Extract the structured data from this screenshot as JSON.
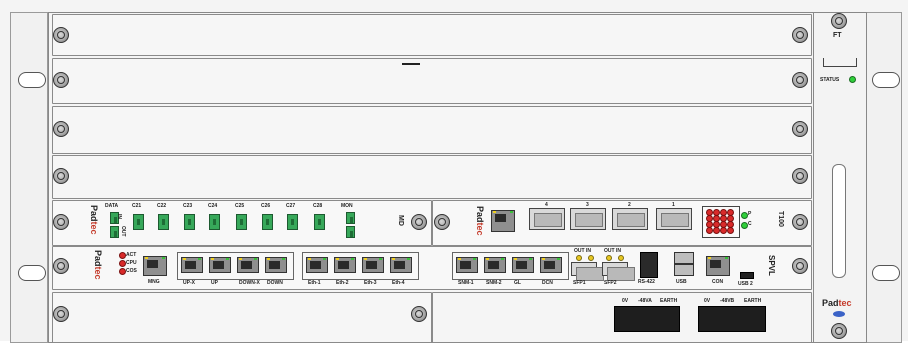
{
  "colors": {
    "led_green": "#2fcf3a",
    "led_red": "#d92a2a",
    "led_yellow": "#e7c722",
    "sc_green": "#37a85a"
  },
  "icons": [
    "screw-icon",
    "handle-icon",
    "led-icon",
    "rj45-port-icon",
    "sfp-port-icon",
    "sc-connector-icon",
    "usb-port-icon",
    "power-connector-icon"
  ],
  "fan": {
    "title": "FT",
    "status": "STATUS"
  },
  "md": {
    "name": "MD",
    "brand_a": "Pad",
    "brand_b": "tec",
    "ports": [
      "DATA",
      "C21",
      "C22",
      "C23",
      "C24",
      "C25",
      "C26",
      "C27",
      "C28",
      "MON"
    ],
    "in": "IN",
    "out": "OUT"
  },
  "t100": {
    "name": "T100",
    "brand_a": "Pad",
    "brand_b": "tec",
    "sfp_nums": [
      "4",
      "3",
      "2",
      "1"
    ],
    "led_labels": [
      "P",
      "C"
    ]
  },
  "spvl": {
    "name": "SPVL",
    "brand_a": "Pad",
    "brand_b": "tec",
    "leds": [
      "ACT",
      "CPU",
      "COS"
    ],
    "mgmt": "MNG",
    "groups": [
      {
        "labels": [
          "UP-X",
          "UP",
          "DOWN-X",
          "DOWN"
        ]
      },
      {
        "labels": [
          "Eth-1",
          "Eth-2",
          "Eth-3",
          "Eth-4"
        ]
      },
      {
        "labels": [
          "SNM-1",
          "SNM-2",
          "GL",
          "DCN"
        ]
      }
    ],
    "sfp_labels": [
      "SFP1",
      "SFP2"
    ],
    "sfp_io": [
      "OUT",
      "IN",
      "OUT",
      "IN"
    ],
    "rs": "RS-422",
    "usb": "USB",
    "con": "CON",
    "usb2": "USB 2"
  },
  "power": {
    "labels_a": [
      "0V",
      "-48VA",
      "EARTH"
    ],
    "labels_b": [
      "0V",
      "-48VB",
      "EARTH"
    ]
  },
  "brand": {
    "a": "Pad",
    "b": "tec"
  }
}
